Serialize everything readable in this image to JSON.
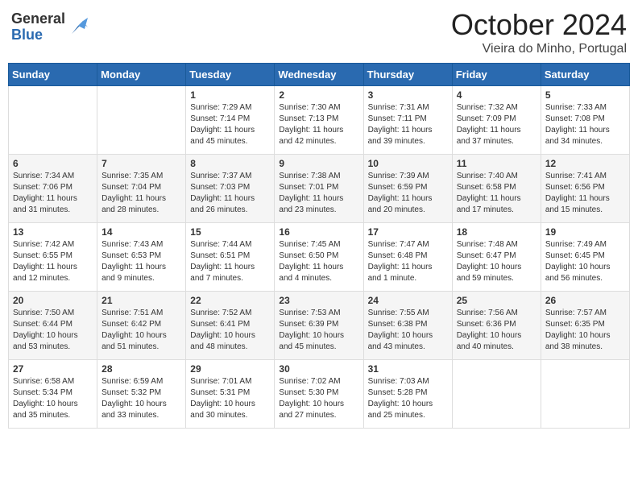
{
  "header": {
    "logo_general": "General",
    "logo_blue": "Blue",
    "month_title": "October 2024",
    "location": "Vieira do Minho, Portugal"
  },
  "days_of_week": [
    "Sunday",
    "Monday",
    "Tuesday",
    "Wednesday",
    "Thursday",
    "Friday",
    "Saturday"
  ],
  "weeks": [
    [
      {
        "day": "",
        "info": ""
      },
      {
        "day": "",
        "info": ""
      },
      {
        "day": "1",
        "info": "Sunrise: 7:29 AM\nSunset: 7:14 PM\nDaylight: 11 hours and 45 minutes."
      },
      {
        "day": "2",
        "info": "Sunrise: 7:30 AM\nSunset: 7:13 PM\nDaylight: 11 hours and 42 minutes."
      },
      {
        "day": "3",
        "info": "Sunrise: 7:31 AM\nSunset: 7:11 PM\nDaylight: 11 hours and 39 minutes."
      },
      {
        "day": "4",
        "info": "Sunrise: 7:32 AM\nSunset: 7:09 PM\nDaylight: 11 hours and 37 minutes."
      },
      {
        "day": "5",
        "info": "Sunrise: 7:33 AM\nSunset: 7:08 PM\nDaylight: 11 hours and 34 minutes."
      }
    ],
    [
      {
        "day": "6",
        "info": "Sunrise: 7:34 AM\nSunset: 7:06 PM\nDaylight: 11 hours and 31 minutes."
      },
      {
        "day": "7",
        "info": "Sunrise: 7:35 AM\nSunset: 7:04 PM\nDaylight: 11 hours and 28 minutes."
      },
      {
        "day": "8",
        "info": "Sunrise: 7:37 AM\nSunset: 7:03 PM\nDaylight: 11 hours and 26 minutes."
      },
      {
        "day": "9",
        "info": "Sunrise: 7:38 AM\nSunset: 7:01 PM\nDaylight: 11 hours and 23 minutes."
      },
      {
        "day": "10",
        "info": "Sunrise: 7:39 AM\nSunset: 6:59 PM\nDaylight: 11 hours and 20 minutes."
      },
      {
        "day": "11",
        "info": "Sunrise: 7:40 AM\nSunset: 6:58 PM\nDaylight: 11 hours and 17 minutes."
      },
      {
        "day": "12",
        "info": "Sunrise: 7:41 AM\nSunset: 6:56 PM\nDaylight: 11 hours and 15 minutes."
      }
    ],
    [
      {
        "day": "13",
        "info": "Sunrise: 7:42 AM\nSunset: 6:55 PM\nDaylight: 11 hours and 12 minutes."
      },
      {
        "day": "14",
        "info": "Sunrise: 7:43 AM\nSunset: 6:53 PM\nDaylight: 11 hours and 9 minutes."
      },
      {
        "day": "15",
        "info": "Sunrise: 7:44 AM\nSunset: 6:51 PM\nDaylight: 11 hours and 7 minutes."
      },
      {
        "day": "16",
        "info": "Sunrise: 7:45 AM\nSunset: 6:50 PM\nDaylight: 11 hours and 4 minutes."
      },
      {
        "day": "17",
        "info": "Sunrise: 7:47 AM\nSunset: 6:48 PM\nDaylight: 11 hours and 1 minute."
      },
      {
        "day": "18",
        "info": "Sunrise: 7:48 AM\nSunset: 6:47 PM\nDaylight: 10 hours and 59 minutes."
      },
      {
        "day": "19",
        "info": "Sunrise: 7:49 AM\nSunset: 6:45 PM\nDaylight: 10 hours and 56 minutes."
      }
    ],
    [
      {
        "day": "20",
        "info": "Sunrise: 7:50 AM\nSunset: 6:44 PM\nDaylight: 10 hours and 53 minutes."
      },
      {
        "day": "21",
        "info": "Sunrise: 7:51 AM\nSunset: 6:42 PM\nDaylight: 10 hours and 51 minutes."
      },
      {
        "day": "22",
        "info": "Sunrise: 7:52 AM\nSunset: 6:41 PM\nDaylight: 10 hours and 48 minutes."
      },
      {
        "day": "23",
        "info": "Sunrise: 7:53 AM\nSunset: 6:39 PM\nDaylight: 10 hours and 45 minutes."
      },
      {
        "day": "24",
        "info": "Sunrise: 7:55 AM\nSunset: 6:38 PM\nDaylight: 10 hours and 43 minutes."
      },
      {
        "day": "25",
        "info": "Sunrise: 7:56 AM\nSunset: 6:36 PM\nDaylight: 10 hours and 40 minutes."
      },
      {
        "day": "26",
        "info": "Sunrise: 7:57 AM\nSunset: 6:35 PM\nDaylight: 10 hours and 38 minutes."
      }
    ],
    [
      {
        "day": "27",
        "info": "Sunrise: 6:58 AM\nSunset: 5:34 PM\nDaylight: 10 hours and 35 minutes."
      },
      {
        "day": "28",
        "info": "Sunrise: 6:59 AM\nSunset: 5:32 PM\nDaylight: 10 hours and 33 minutes."
      },
      {
        "day": "29",
        "info": "Sunrise: 7:01 AM\nSunset: 5:31 PM\nDaylight: 10 hours and 30 minutes."
      },
      {
        "day": "30",
        "info": "Sunrise: 7:02 AM\nSunset: 5:30 PM\nDaylight: 10 hours and 27 minutes."
      },
      {
        "day": "31",
        "info": "Sunrise: 7:03 AM\nSunset: 5:28 PM\nDaylight: 10 hours and 25 minutes."
      },
      {
        "day": "",
        "info": ""
      },
      {
        "day": "",
        "info": ""
      }
    ]
  ]
}
